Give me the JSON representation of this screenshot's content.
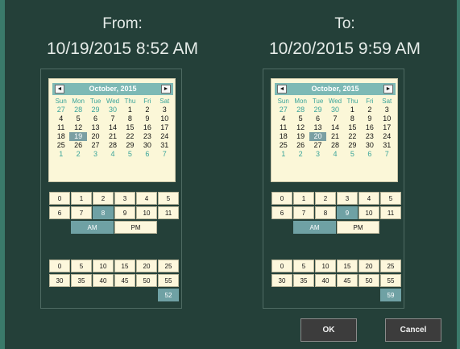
{
  "from": {
    "label": "From:",
    "datetime": "10/19/2015 8:52 AM",
    "calendar": {
      "title": "October, 2015",
      "prev_glyph": "◄",
      "next_glyph": "►",
      "weekdays": [
        "Sun",
        "Mon",
        "Tue",
        "Wed",
        "Thu",
        "Fri",
        "Sat"
      ],
      "selected_day": "19",
      "days": [
        "27",
        "28",
        "29",
        "30",
        "1",
        "2",
        "3",
        "4",
        "5",
        "6",
        "7",
        "8",
        "9",
        "10",
        "11",
        "12",
        "13",
        "14",
        "15",
        "16",
        "17",
        "18",
        "19",
        "20",
        "21",
        "22",
        "23",
        "24",
        "25",
        "26",
        "27",
        "28",
        "29",
        "30",
        "31",
        "1",
        "2",
        "3",
        "4",
        "5",
        "6",
        "7"
      ]
    },
    "hours": [
      "0",
      "1",
      "2",
      "3",
      "4",
      "5",
      "6",
      "7",
      "8",
      "9",
      "10",
      "11"
    ],
    "selected_hour": "8",
    "am_label": "AM",
    "pm_label": "PM",
    "selected_period": "AM",
    "minutes": [
      "0",
      "5",
      "10",
      "15",
      "20",
      "25",
      "30",
      "35",
      "40",
      "45",
      "50",
      "55"
    ],
    "minute_value": "52"
  },
  "to": {
    "label": "To:",
    "datetime": "10/20/2015 9:59 AM",
    "calendar": {
      "title": "October, 2015",
      "prev_glyph": "◄",
      "next_glyph": "►",
      "weekdays": [
        "Sun",
        "Mon",
        "Tue",
        "Wed",
        "Thu",
        "Fri",
        "Sat"
      ],
      "selected_day": "20",
      "days": [
        "27",
        "28",
        "29",
        "30",
        "1",
        "2",
        "3",
        "4",
        "5",
        "6",
        "7",
        "8",
        "9",
        "10",
        "11",
        "12",
        "13",
        "14",
        "15",
        "16",
        "17",
        "18",
        "19",
        "20",
        "21",
        "22",
        "23",
        "24",
        "25",
        "26",
        "27",
        "28",
        "29",
        "30",
        "31",
        "1",
        "2",
        "3",
        "4",
        "5",
        "6",
        "7"
      ]
    },
    "hours": [
      "0",
      "1",
      "2",
      "3",
      "4",
      "5",
      "6",
      "7",
      "8",
      "9",
      "10",
      "11"
    ],
    "selected_hour": "9",
    "am_label": "AM",
    "pm_label": "PM",
    "selected_period": "AM",
    "minutes": [
      "0",
      "5",
      "10",
      "15",
      "20",
      "25",
      "30",
      "35",
      "40",
      "45",
      "50",
      "55"
    ],
    "minute_value": "59"
  },
  "buttons": {
    "ok": "OK",
    "cancel": "Cancel"
  }
}
